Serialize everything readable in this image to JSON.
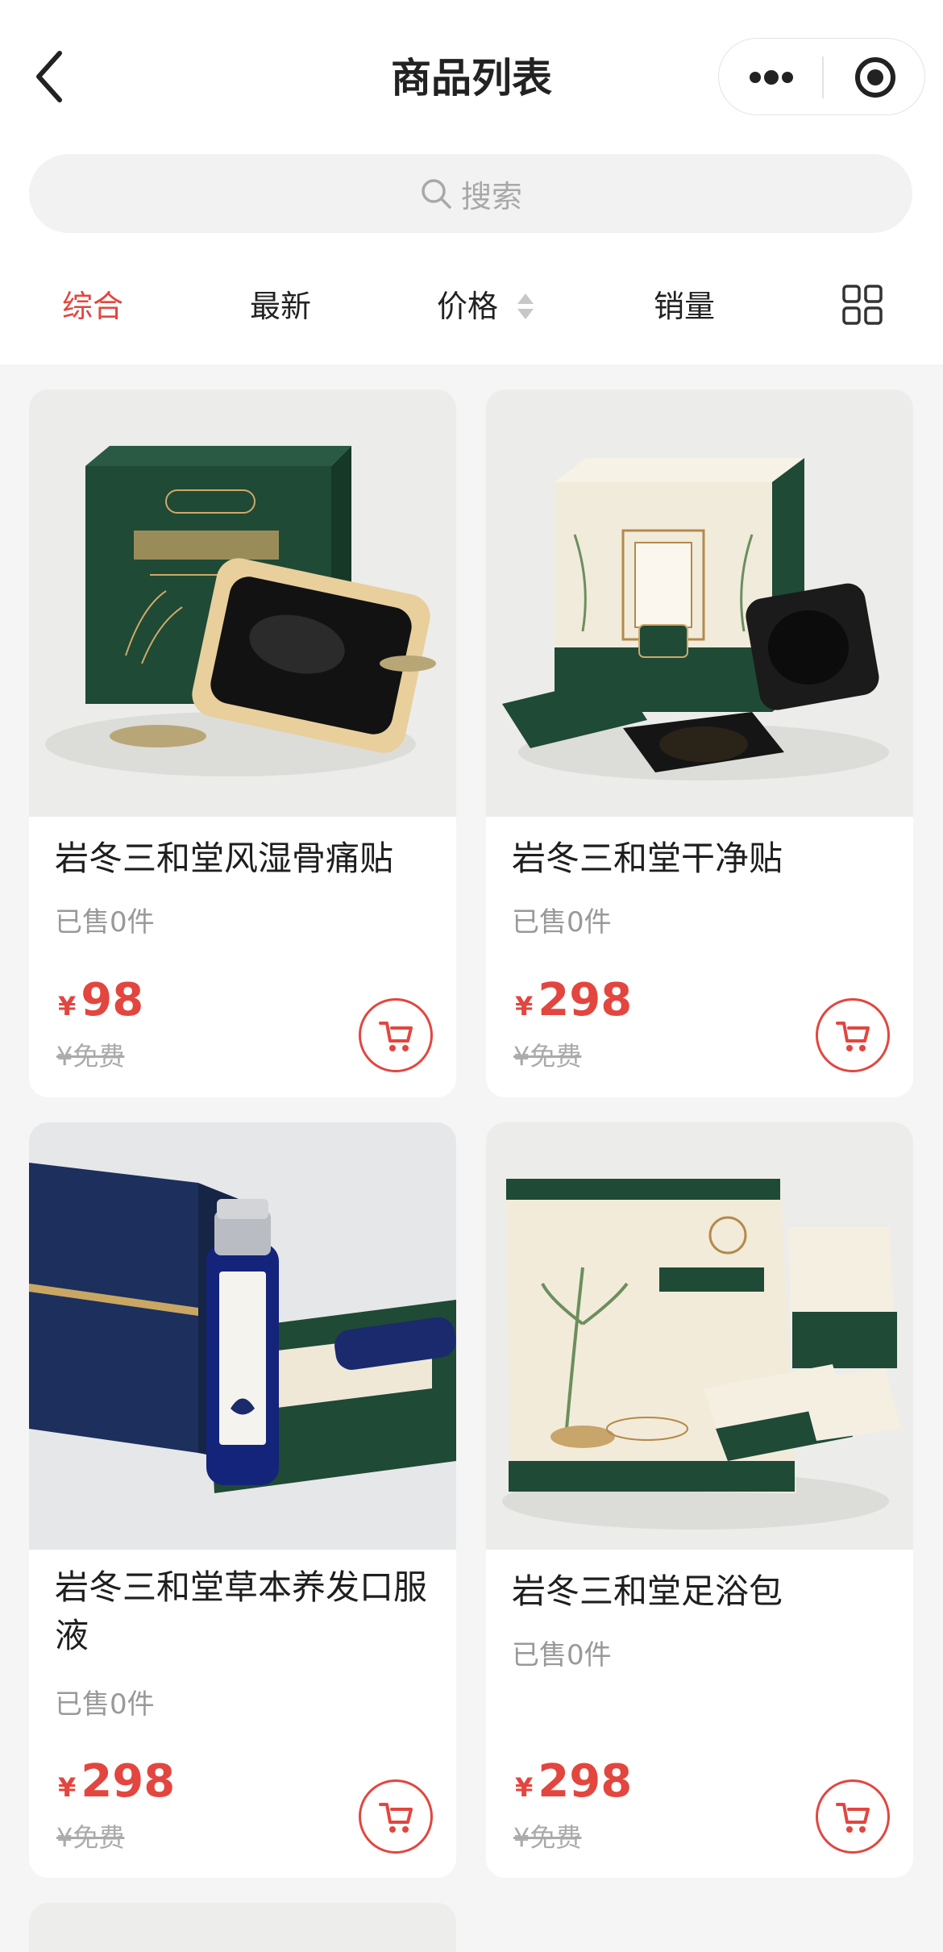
{
  "nav": {
    "title": "商品列表"
  },
  "search": {
    "placeholder": "搜索"
  },
  "tabs": [
    "综合",
    "最新",
    "价格",
    "销量"
  ],
  "active_tab": "综合",
  "colors": {
    "accent": "#e2463f",
    "brand_green": "#1f4a35"
  },
  "products": [
    {
      "name": "岩冬三和堂风湿骨痛贴",
      "sold": "已售0件",
      "currency": "¥",
      "price": "98",
      "orig": "¥免费",
      "image": "green box of rheumatism plaster with black square patch and dried herbs"
    },
    {
      "name": "岩冬三和堂干净贴",
      "sold": "已售0件",
      "currency": "¥",
      "price": "298",
      "orig": "¥免费",
      "image": "cream and green box of herbal clean patch with black patches and sachet"
    },
    {
      "name": "岩冬三和堂草本养发口服液",
      "sold": "已售0件",
      "currency": "¥",
      "price": "298",
      "orig": "¥免费",
      "image": "blue glass vial of herbal hair oral liquid in navy gift box"
    },
    {
      "name": "岩冬三和堂足浴包",
      "sold": "已售0件",
      "currency": "¥",
      "price": "298",
      "orig": "¥免费",
      "image": "cream and green herbal foot bath bag with small sachets"
    }
  ]
}
